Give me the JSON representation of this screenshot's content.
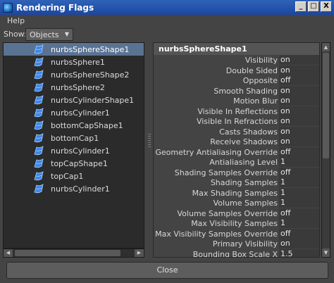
{
  "window": {
    "title": "Rendering Flags",
    "buttons": {
      "minimize": "_",
      "maximize": "□",
      "close": "X"
    }
  },
  "menu": {
    "help": "Help"
  },
  "show": {
    "label": "Show:",
    "value": "Objects"
  },
  "outliner": {
    "selected_index": 0,
    "items": [
      "nurbsSphereShape1",
      "nurbsSphere1",
      "nurbsSphereShape2",
      "nurbsSphere2",
      "nurbsCylinderShape1",
      "nurbsCylinder1",
      "bottomCapShape1",
      "bottomCap1",
      "nurbsCylinder1",
      "topCapShape1",
      "topCap1",
      "nurbsCylinder1"
    ]
  },
  "attributes": {
    "header": "nurbsSphereShape1",
    "rows": [
      {
        "label": "Visibility",
        "value": "on"
      },
      {
        "label": "Double Sided",
        "value": "on"
      },
      {
        "label": "Opposite",
        "value": "off"
      },
      {
        "label": "Smooth Shading",
        "value": "on"
      },
      {
        "label": "Motion Blur",
        "value": "on"
      },
      {
        "label": "Visible In Reflections",
        "value": "on"
      },
      {
        "label": "Visible In Refractions",
        "value": "on"
      },
      {
        "label": "Casts Shadows",
        "value": "on"
      },
      {
        "label": "Receive Shadows",
        "value": "on"
      },
      {
        "label": "Geometry Antialiasing Override",
        "value": "off"
      },
      {
        "label": "Antialiasing Level",
        "value": "1"
      },
      {
        "label": "Shading Samples Override",
        "value": "off"
      },
      {
        "label": "Shading Samples",
        "value": "1"
      },
      {
        "label": "Max Shading Samples",
        "value": "1"
      },
      {
        "label": "Volume Samples",
        "value": "1"
      },
      {
        "label": "Volume Samples Override",
        "value": "off"
      },
      {
        "label": "Max Visibility Samples",
        "value": "1"
      },
      {
        "label": "Max Visibility Samples Override",
        "value": "off"
      },
      {
        "label": "Primary Visibility",
        "value": "on"
      },
      {
        "label": "Bounding Box Scale X",
        "value": "1.5"
      }
    ]
  },
  "footer": {
    "close_label": "Close"
  },
  "colors": {
    "title_bar": "#1c46a0",
    "selection": "#5a7392",
    "panel_bg": "#444444"
  }
}
